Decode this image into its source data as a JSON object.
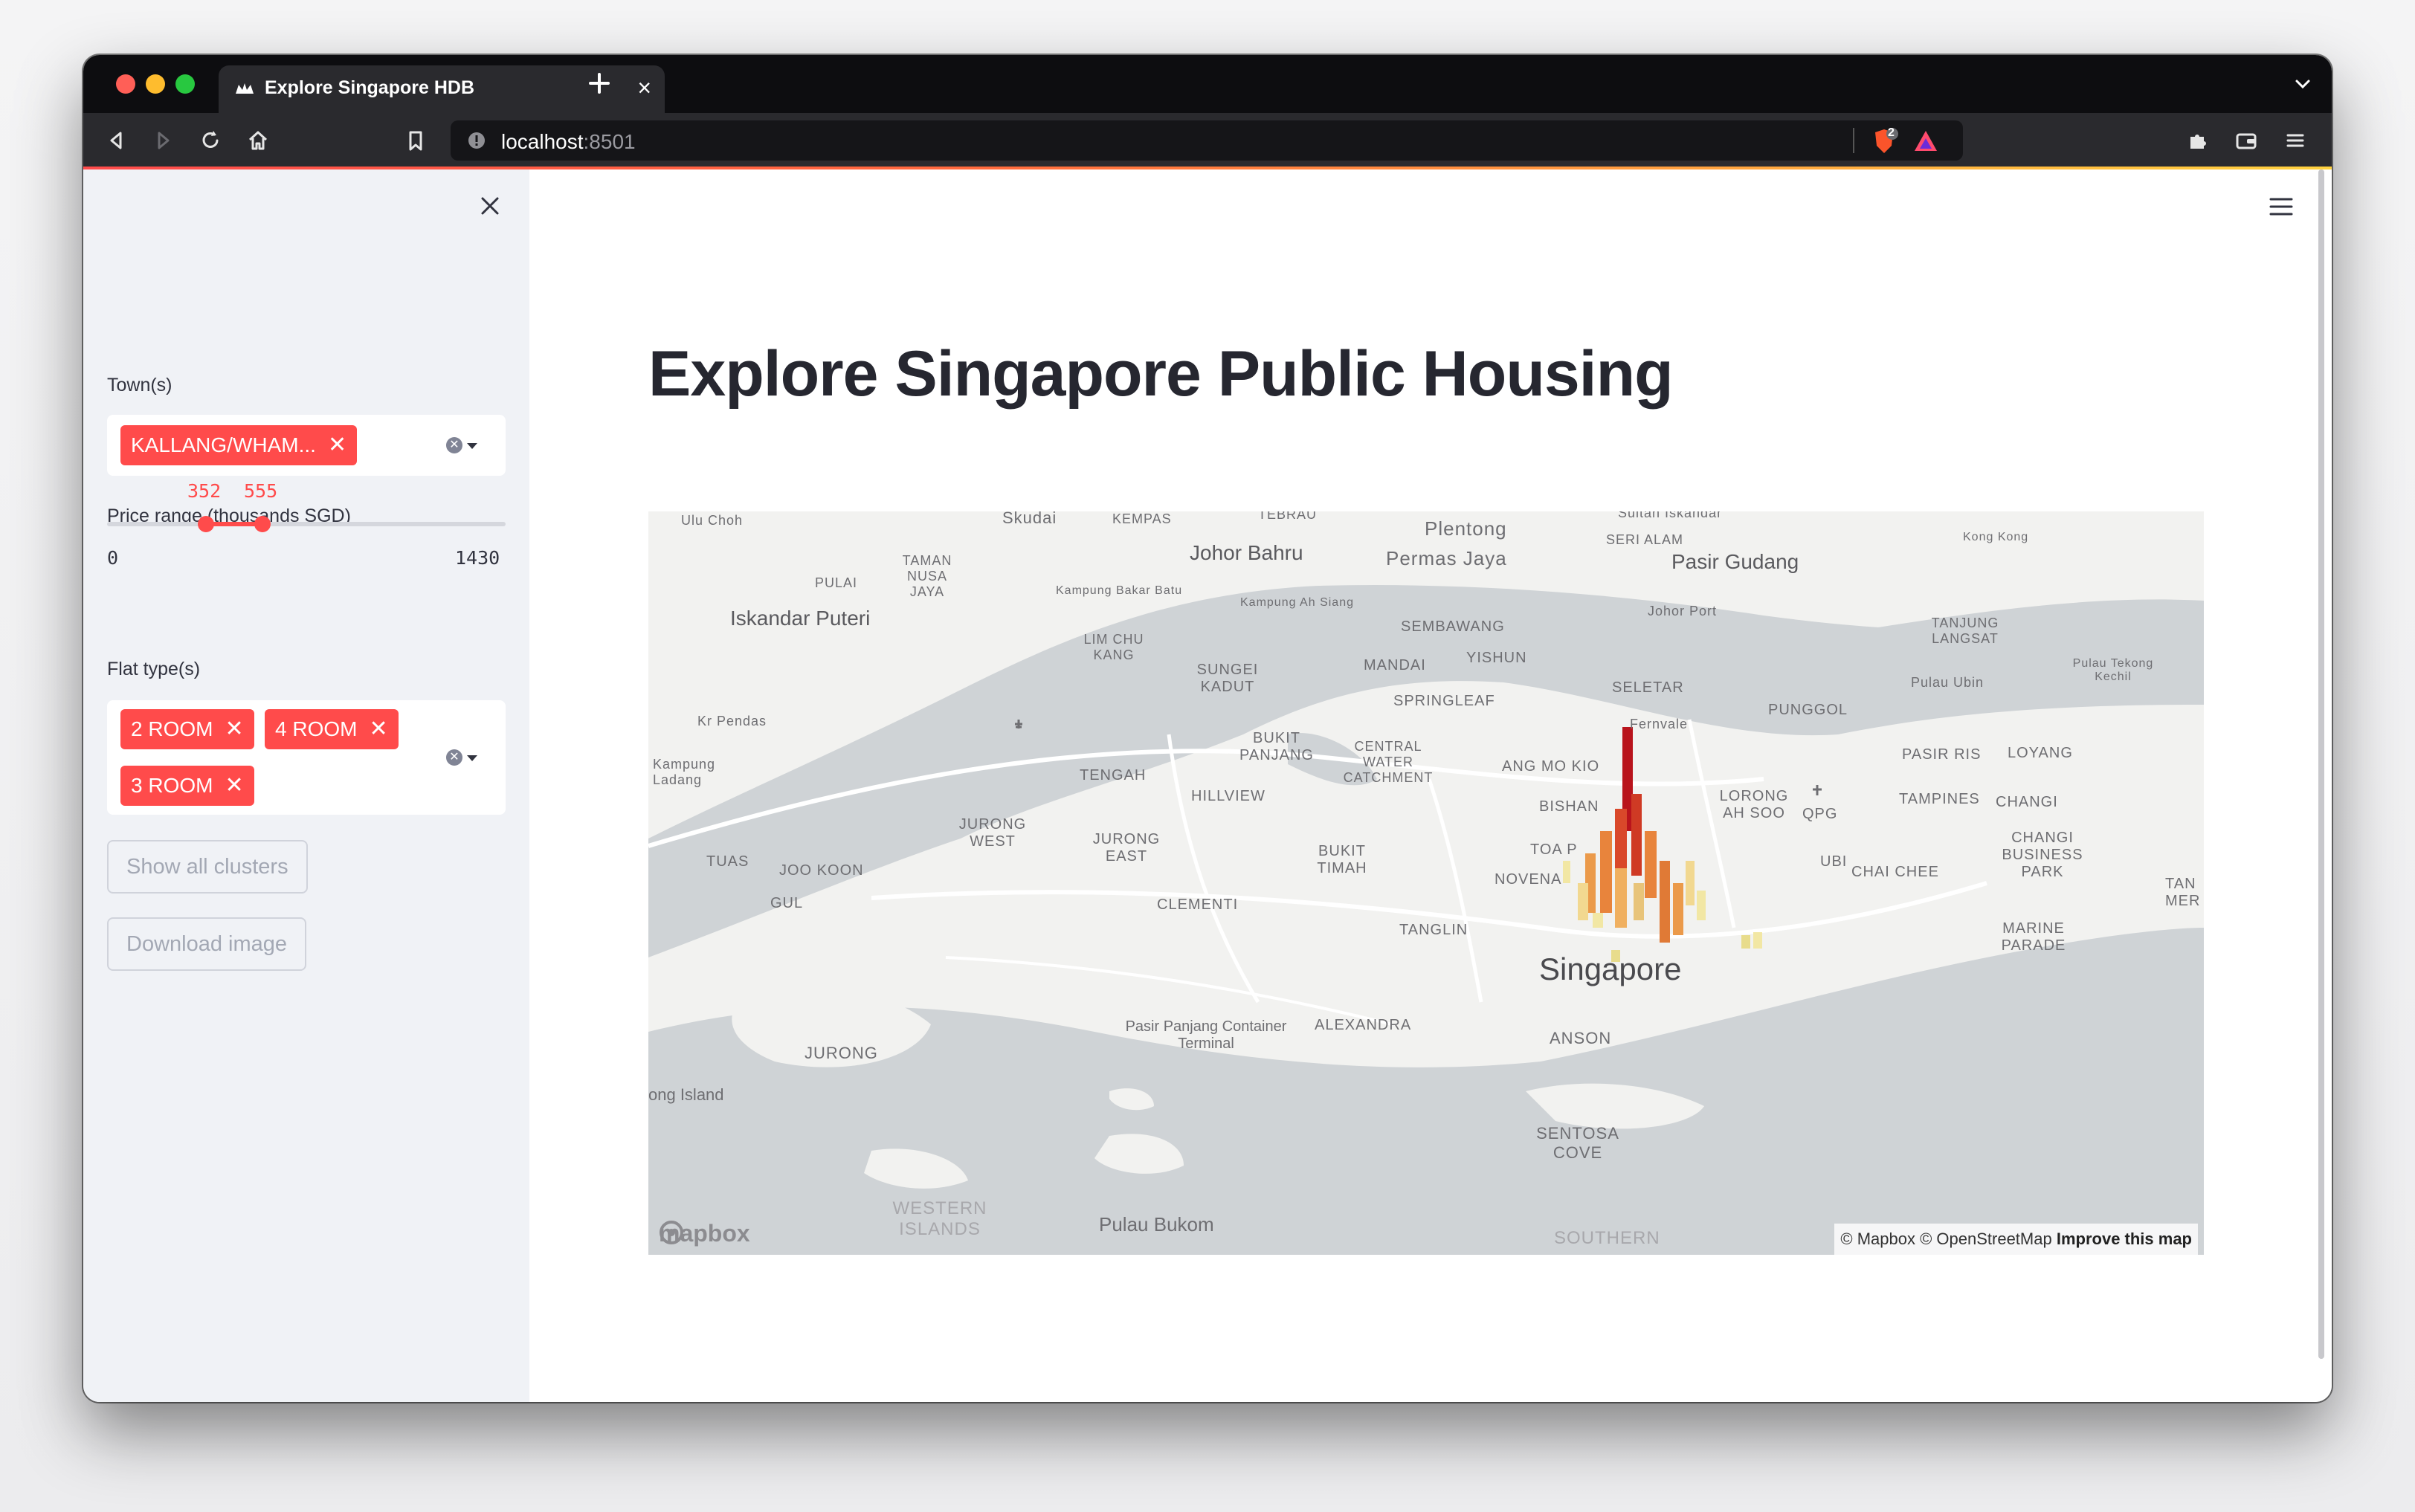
{
  "browser": {
    "tab_title": "Explore Singapore HDB",
    "url_host": "localhost",
    "url_port": ":8501",
    "extension_badge": "2"
  },
  "sidebar": {
    "towns_label": "Town(s)",
    "towns_selected": [
      "KALLANG/WHAM..."
    ],
    "price_label": "Price range (thousands SGD)",
    "price_range": {
      "low": "352",
      "high": "555",
      "min": "0",
      "max": "1430"
    },
    "flat_types_label": "Flat type(s)",
    "flat_types_selected": [
      "2 ROOM",
      "4 ROOM",
      "3 ROOM"
    ],
    "show_clusters_label": "Show all clusters",
    "download_label": "Download image"
  },
  "main": {
    "title": "Explore Singapore Public Housing",
    "map": {
      "labels": {
        "ulu_choh": "Ulu Choh",
        "skudai": "Skudai",
        "kempas": "KEMPAS",
        "tebrau": "TEBRAU",
        "plentong": "Plentong",
        "sultan_iskandar": "Sultan Iskandar",
        "johor_bahru": "Johor Bahru",
        "permas_jaya": "Permas Jaya",
        "seri_alam": "SERI ALAM",
        "pasir_gudang": "Pasir Gudang",
        "kong_kong": "Kong Kong",
        "pulai": "PULAI",
        "taman_nusa_jaya": "TAMAN NUSA JAYA",
        "kampung_bakar_batu": "Kampung Bakar Batu",
        "kampung_ah_siang": "Kampung Ah Siang",
        "johor_port": "Johor Port",
        "iskandar_puteri": "Iskandar Puteri",
        "tanjung_langsat": "TANJUNG LANGSAT",
        "sembawang": "SEMBAWANG",
        "lim_chu_kang": "LIM CHU KANG",
        "mandai": "MANDAI",
        "yishun": "YISHUN",
        "sungei_kadut": "SUNGEI KADUT",
        "seletar": "SELETAR",
        "pulau_ubin": "Pulau Ubin",
        "pulau_tekong_kechil": "Pulau Tekong Kechil",
        "springleaf": "SPRINGLEAF",
        "punggol": "PUNGGOL",
        "kr_pendas": "Kr Pendas",
        "fernvale": "Fernvale",
        "bukit_panjang": "BUKIT PANJANG",
        "central_water_catchment": "CENTRAL WATER CATCHMENT",
        "pasir_ris": "PASIR RIS",
        "loyang": "LOYANG",
        "kampung_ladang": "Kampung Ladang",
        "tengah": "TENGAH",
        "ang_mo_kio": "ANG MO KIO",
        "lorong_ah_soo": "LORONG AH SOO",
        "qpg": "QPG",
        "hillview": "HILLVIEW",
        "bishan": "BISHAN",
        "tampines": "TAMPINES",
        "changi": "CHANGI",
        "jurong_west": "JURONG WEST",
        "jurong_east": "JURONG EAST",
        "bukit_timah": "BUKIT TIMAH",
        "toa_payoh": "TOA P",
        "changi_business_park": "CHANGI BUSINESS PARK",
        "tuas": "TUAS",
        "joo_koon": "JOO KOON",
        "ubi": "UBI",
        "chai_chee": "CHAI CHEE",
        "novena": "NOVENA",
        "gul": "GUL",
        "clementi": "CLEMENTI",
        "tan_mer": "TAN MER",
        "marine_parade": "MARINE PARADE",
        "tanglin": "TANGLIN",
        "singapore": "Singapore",
        "pasir_panjang": "Pasir Panjang Container Terminal",
        "alexandra": "ALEXANDRA",
        "jurong": "JURONG",
        "anson": "ANSON",
        "long_island": "ong Island",
        "sentosa_cove": "SENTOSA COVE",
        "western_islands": "WESTERN ISLANDS",
        "pulau_bukom": "Pulau Bukom",
        "southern": "SOUTHERN"
      },
      "logo": "mapbox",
      "attribution": "© Mapbox © OpenStreetMap",
      "improve": "Improve this map"
    }
  },
  "colors": {
    "accent": "#ff4b4b",
    "sidebar_bg": "#f0f2f6",
    "text": "#31333f",
    "bar_low": "#f2e7a4",
    "bar_mid": "#e8843c",
    "bar_high": "#b9141c"
  }
}
